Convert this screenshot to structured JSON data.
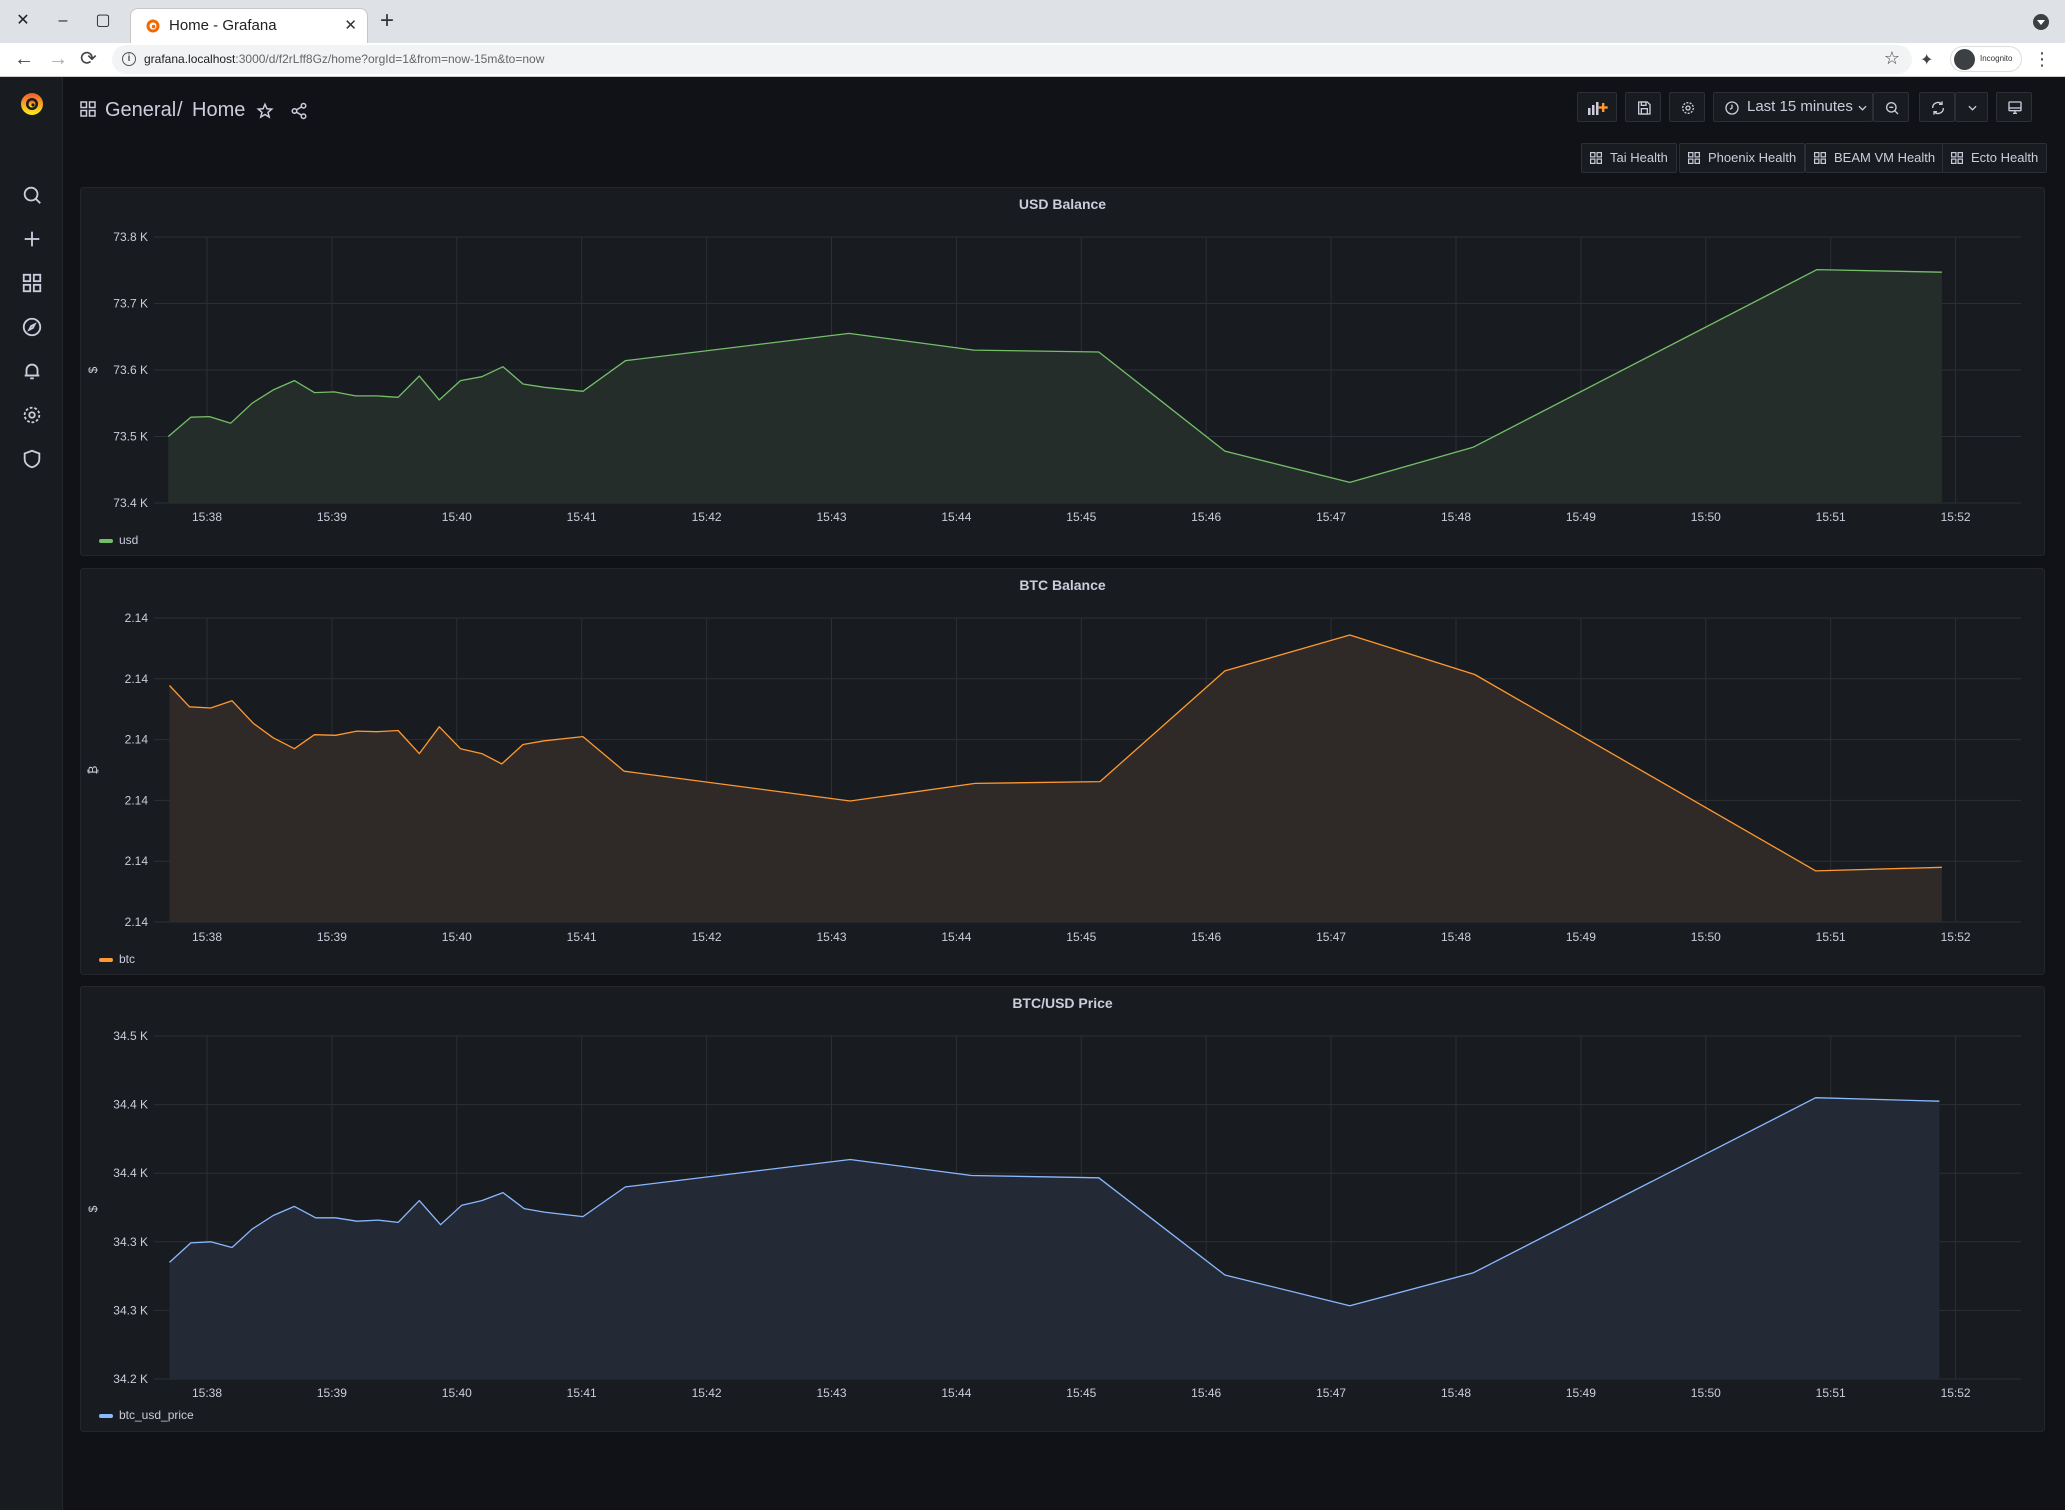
{
  "browser": {
    "window_controls": {
      "close": "✕",
      "minimize": "–",
      "maximize": "▢"
    },
    "tab": {
      "title": "Home - Grafana",
      "close": "✕"
    },
    "new_tab": "+",
    "url_host": "grafana.localhost",
    "url_rest": ":3000/d/f2rLff8Gz/home?orgId=1&from=now-15m&to=now",
    "profile_label": "Incognito",
    "nav": {
      "back": "←",
      "forward": "→",
      "reload": "⟳"
    }
  },
  "grafana": {
    "sidebar": {
      "items": [
        {
          "name": "search",
          "icon": "search-icon"
        },
        {
          "name": "create",
          "icon": "plus-icon"
        },
        {
          "name": "dashboards",
          "icon": "apps-icon"
        },
        {
          "name": "explore",
          "icon": "compass-icon"
        },
        {
          "name": "alerting",
          "icon": "bell-icon"
        },
        {
          "name": "configuration",
          "icon": "gear-icon"
        },
        {
          "name": "server-admin",
          "icon": "shield-icon"
        }
      ]
    },
    "breadcrumb": {
      "folder": "General",
      "separator": "/",
      "dashboard": "Home"
    },
    "toolbar": {
      "time_range": "Last 15 minutes",
      "add_panel": "add-panel-icon",
      "save": "save-icon",
      "settings": "gear-icon",
      "zoom_out": "zoom-out-icon",
      "refresh": "refresh-icon",
      "view_mode": "monitor-icon"
    },
    "dashboard_links": [
      "Tai Health",
      "Phoenix Health",
      "BEAM VM Health",
      "Ecto Health"
    ],
    "panels": [
      {
        "title": "USD Balance",
        "legend": "usd",
        "color": "#73bf69",
        "fill": "#252d2b",
        "unit_label": "$"
      },
      {
        "title": "BTC Balance",
        "legend": "btc",
        "color": "#ff9830",
        "fill": "#2f2a27",
        "unit_label": "₿"
      },
      {
        "title": "BTC/USD Price",
        "legend": "btc_usd_price",
        "color": "#8ab8ff",
        "fill": "#232a36",
        "unit_label": "$"
      }
    ]
  },
  "chart_data": [
    {
      "type": "area",
      "title": "USD Balance",
      "xlabel": "",
      "ylabel": "$",
      "legend": [
        "usd"
      ],
      "legend_position": "bottom-left",
      "grid": true,
      "x_ticks": [
        "15:38",
        "15:39",
        "15:40",
        "15:41",
        "15:42",
        "15:43",
        "15:44",
        "15:45",
        "15:46",
        "15:47",
        "15:48",
        "15:49",
        "15:50",
        "15:51",
        "15:52"
      ],
      "xlim_minutes": [
        37.3,
        52.4
      ],
      "y_ticks": [
        "73.4 K",
        "73.5 K",
        "73.6 K",
        "73.7 K",
        "73.8 K"
      ],
      "y_tick_values": [
        73400,
        73500,
        73600,
        73700,
        73800
      ],
      "ylim": [
        73400,
        73800
      ],
      "series": [
        {
          "name": "usd",
          "x_minutes_after_15h": [
            37.69,
            37.87,
            38.02,
            38.19,
            38.36,
            38.53,
            38.7,
            38.86,
            39.02,
            39.19,
            39.36,
            39.53,
            39.7,
            39.86,
            40.03,
            40.2,
            40.37,
            40.53,
            40.7,
            41.01,
            41.35,
            43.14,
            44.14,
            45.14,
            46.15,
            47.15,
            48.14,
            50.89,
            51.89
          ],
          "values": [
            73500,
            73529,
            73530,
            73520,
            73550,
            73570,
            73584,
            73566,
            73567,
            73561,
            73561,
            73559,
            73591,
            73555,
            73584,
            73590,
            73605,
            73579,
            73574,
            73568,
            73614,
            73655,
            73630,
            73627,
            73478,
            73431,
            73484,
            73751,
            73747
          ]
        }
      ]
    },
    {
      "type": "area",
      "title": "BTC Balance",
      "xlabel": "",
      "ylabel": "₿",
      "legend": [
        "btc"
      ],
      "legend_position": "bottom-left",
      "grid": true,
      "x_ticks": [
        "15:38",
        "15:39",
        "15:40",
        "15:41",
        "15:42",
        "15:43",
        "15:44",
        "15:45",
        "15:46",
        "15:47",
        "15:48",
        "15:49",
        "15:50",
        "15:51",
        "15:52"
      ],
      "xlim_minutes": [
        37.3,
        52.4
      ],
      "y_ticks": [
        "2.14",
        "2.14",
        "2.14",
        "2.14",
        "2.14",
        "2.14"
      ],
      "y_tick_levels": [
        0,
        1,
        2,
        3,
        4,
        5
      ],
      "ylim_levels": [
        0,
        5
      ],
      "note": "all tick labels read 2.14; values expressed as relative tick-level positions (0 = bottom tick, 5 = top tick)",
      "series": [
        {
          "name": "btc",
          "x_minutes_after_15h": [
            37.7,
            37.86,
            38.03,
            38.2,
            38.37,
            38.53,
            38.7,
            38.86,
            39.03,
            39.2,
            39.36,
            39.53,
            39.7,
            39.86,
            40.03,
            40.2,
            40.36,
            40.53,
            40.7,
            41.01,
            41.34,
            43.15,
            44.15,
            45.15,
            46.15,
            47.15,
            48.15,
            50.88,
            51.89
          ],
          "values": [
            3.89,
            3.54,
            3.52,
            3.64,
            3.27,
            3.03,
            2.85,
            3.08,
            3.07,
            3.14,
            3.13,
            3.15,
            2.77,
            3.21,
            2.85,
            2.77,
            2.6,
            2.92,
            2.98,
            3.05,
            2.48,
            1.99,
            2.28,
            2.31,
            4.13,
            4.72,
            4.07,
            0.84,
            0.9
          ]
        }
      ]
    },
    {
      "type": "area",
      "title": "BTC/USD Price",
      "xlabel": "",
      "ylabel": "$",
      "legend": [
        "btc_usd_price"
      ],
      "legend_position": "bottom-left",
      "grid": true,
      "x_ticks": [
        "15:38",
        "15:39",
        "15:40",
        "15:41",
        "15:42",
        "15:43",
        "15:44",
        "15:45",
        "15:46",
        "15:47",
        "15:48",
        "15:49",
        "15:50",
        "15:51",
        "15:52"
      ],
      "xlim_minutes": [
        37.3,
        52.4
      ],
      "y_ticks": [
        "34.2 K",
        "34.3 K",
        "34.3 K",
        "34.4 K",
        "34.4 K",
        "34.5 K"
      ],
      "y_tick_values": [
        34200,
        34260,
        34320,
        34380,
        34440,
        34500
      ],
      "ylim": [
        34200,
        34500
      ],
      "series": [
        {
          "name": "btc_usd_price",
          "x_minutes_after_15h": [
            37.7,
            37.87,
            38.03,
            38.2,
            38.36,
            38.53,
            38.7,
            38.87,
            39.03,
            39.2,
            39.37,
            39.53,
            39.7,
            39.87,
            40.04,
            40.2,
            40.37,
            40.54,
            40.7,
            41.01,
            41.35,
            43.15,
            44.12,
            45.14,
            46.15,
            47.15,
            48.14,
            50.88,
            51.87
          ],
          "values": [
            34302,
            34319,
            34320,
            34315,
            34331,
            34343,
            34351,
            34341,
            34341,
            34338,
            34339,
            34337,
            34356,
            34335,
            34352,
            34356,
            34363,
            34349,
            34346,
            34342,
            34368,
            34392,
            34378,
            34376,
            34291,
            34264,
            34293,
            34446,
            34443
          ]
        }
      ]
    }
  ]
}
